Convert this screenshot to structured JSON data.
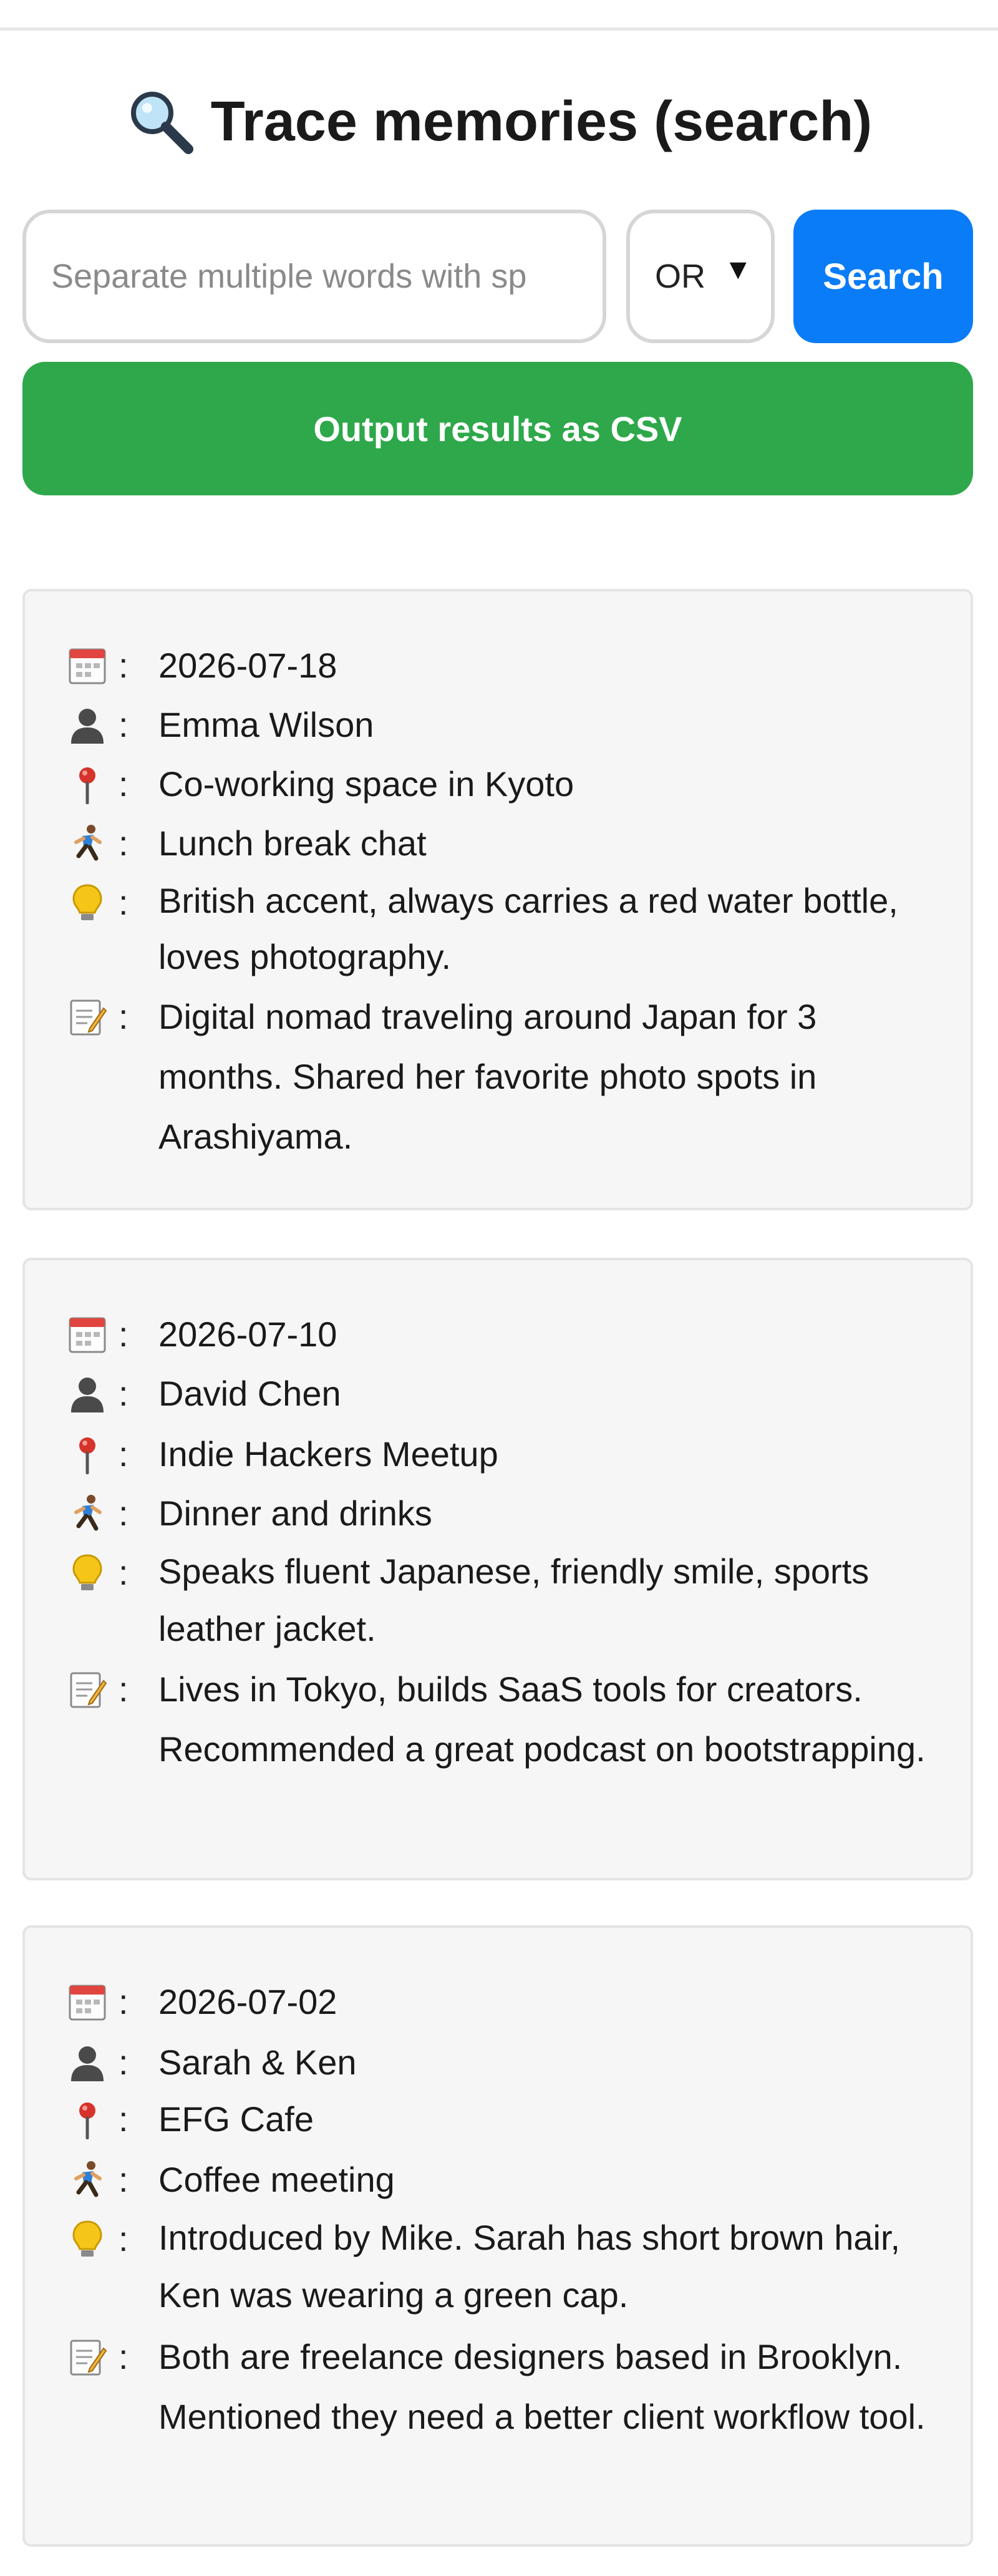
{
  "title": "Trace memories (search)",
  "search": {
    "placeholder": "Separate multiple words with sp",
    "value": "",
    "operator": "OR",
    "button_label": "Search"
  },
  "csv_button_label": "Output results as CSV",
  "colors": {
    "search_button": "#0a7cf7",
    "csv_button": "#2ea84a"
  },
  "field_icons": [
    "calendar-icon",
    "person-icon",
    "pin-icon",
    "runner-icon",
    "lightbulb-icon",
    "memo-icon"
  ],
  "entries": [
    {
      "date": "2026-07-18",
      "person": "Emma Wilson",
      "place": "Co-working space in Kyoto",
      "occasion": "Lunch break chat",
      "features": "British accent, always carries a red water bottle, loves photography.",
      "notes": "Digital nomad traveling around Japan for 3 months. Shared her favorite photo spots in Arashiyama."
    },
    {
      "date": "2026-07-10",
      "person": "David Chen",
      "place": "Indie Hackers Meetup",
      "occasion": "Dinner and drinks",
      "features": "Speaks fluent Japanese, friendly smile, sports leather jacket.",
      "notes": "Lives in Tokyo, builds SaaS tools for creators. Recommended a great podcast on bootstrapping."
    },
    {
      "date": "2026-07-02",
      "person": "Sarah & Ken",
      "place": "EFG Cafe",
      "occasion": "Coffee meeting",
      "features": "Introduced by Mike. Sarah has short brown hair, Ken was wearing a green cap.",
      "notes": "Both are freelance designers based in Brooklyn. Mentioned they need a better client workflow tool."
    }
  ]
}
